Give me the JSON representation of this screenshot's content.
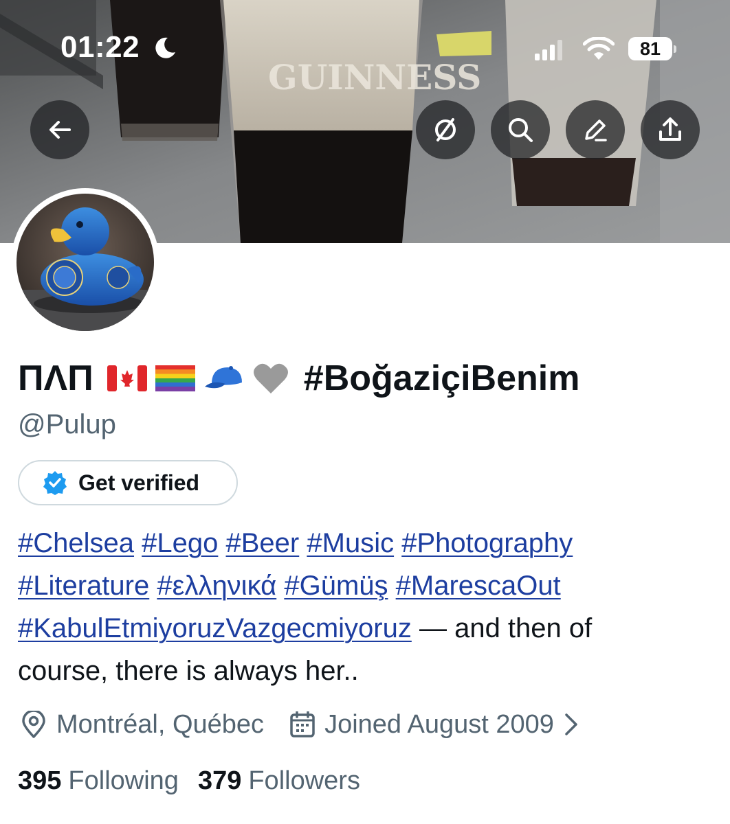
{
  "status_bar": {
    "time": "01:22",
    "battery_level": "81",
    "icons": [
      "moon-icon",
      "signal-icon",
      "wifi-icon",
      "battery-icon"
    ]
  },
  "banner": {
    "image_text": "GUINNESS",
    "buttons": [
      "back-arrow-icon",
      "grok-icon",
      "search-icon",
      "edit-icon",
      "share-icon"
    ]
  },
  "profile": {
    "display_name": "ΠΛΠ",
    "name_emojis": [
      "canada-flag",
      "rainbow-flag",
      "blue-cap",
      "grey-heart"
    ],
    "name_hashtag": "#BoğaziçiBenim",
    "handle": "@Pulup",
    "verify_button": "Get verified",
    "bio": {
      "hashtags": [
        "#Chelsea",
        "#Lego",
        "#Beer",
        "#Music",
        "#Photography",
        "#Literature",
        "#ελληνικά",
        "#Gümüş",
        "#MarescaOut",
        "#KabulEtmiyoruzVazgecmiyoruz"
      ],
      "highlighted_hashtag": "#MarescaOut",
      "text_after": " — and then of",
      "text_line2": "course, there is always her.."
    },
    "location": "Montréal, Québec",
    "joined": "Joined August 2009",
    "following_count": "395",
    "following_label": "Following",
    "followers_count": "379",
    "followers_label": "Followers"
  },
  "colors": {
    "link": "#1d3ea0",
    "text": "#0f1419",
    "muted": "#536471",
    "verified_badge": "#1d9bf0",
    "highlight": "#ffdb3c"
  }
}
